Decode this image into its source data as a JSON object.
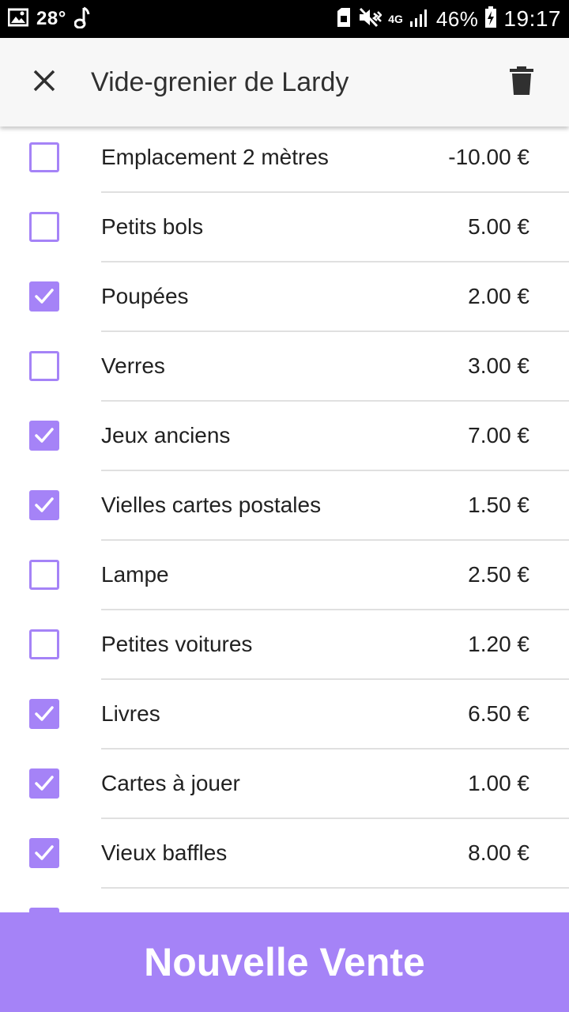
{
  "status_bar": {
    "temperature": "28°",
    "network": "4G",
    "battery": "46%",
    "time": "19:17",
    "icons": [
      "gallery-icon",
      "music-note-icon",
      "sim-icon",
      "mute-vibrate-icon",
      "signal-icon",
      "battery-charging-icon"
    ]
  },
  "app_bar": {
    "title": "Vide-grenier de Lardy",
    "close_icon": "close-icon",
    "delete_icon": "trash-icon"
  },
  "items": [
    {
      "label": "Emplacement 2 mètres",
      "price": "-10.00 €",
      "checked": false
    },
    {
      "label": "Petits bols",
      "price": "5.00 €",
      "checked": false
    },
    {
      "label": "Poupées",
      "price": "2.00 €",
      "checked": true
    },
    {
      "label": "Verres",
      "price": "3.00 €",
      "checked": false
    },
    {
      "label": "Jeux anciens",
      "price": "7.00 €",
      "checked": true
    },
    {
      "label": "Vielles cartes postales",
      "price": "1.50 €",
      "checked": true
    },
    {
      "label": "Lampe",
      "price": "2.50 €",
      "checked": false
    },
    {
      "label": "Petites voitures",
      "price": "1.20 €",
      "checked": false
    },
    {
      "label": "Livres",
      "price": "6.50 €",
      "checked": true
    },
    {
      "label": "Cartes à jouer",
      "price": "1.00 €",
      "checked": true
    },
    {
      "label": "Vieux baffles",
      "price": "8.00 €",
      "checked": true
    },
    {
      "label": "",
      "price": "",
      "checked": true
    }
  ],
  "bottom_button": {
    "label": "Nouvelle Vente"
  },
  "colors": {
    "accent": "#a583f7",
    "app_bar_bg": "#f7f7f7",
    "status_bar_bg": "#000000",
    "divider": "#e0e0e0",
    "text": "#212121"
  }
}
